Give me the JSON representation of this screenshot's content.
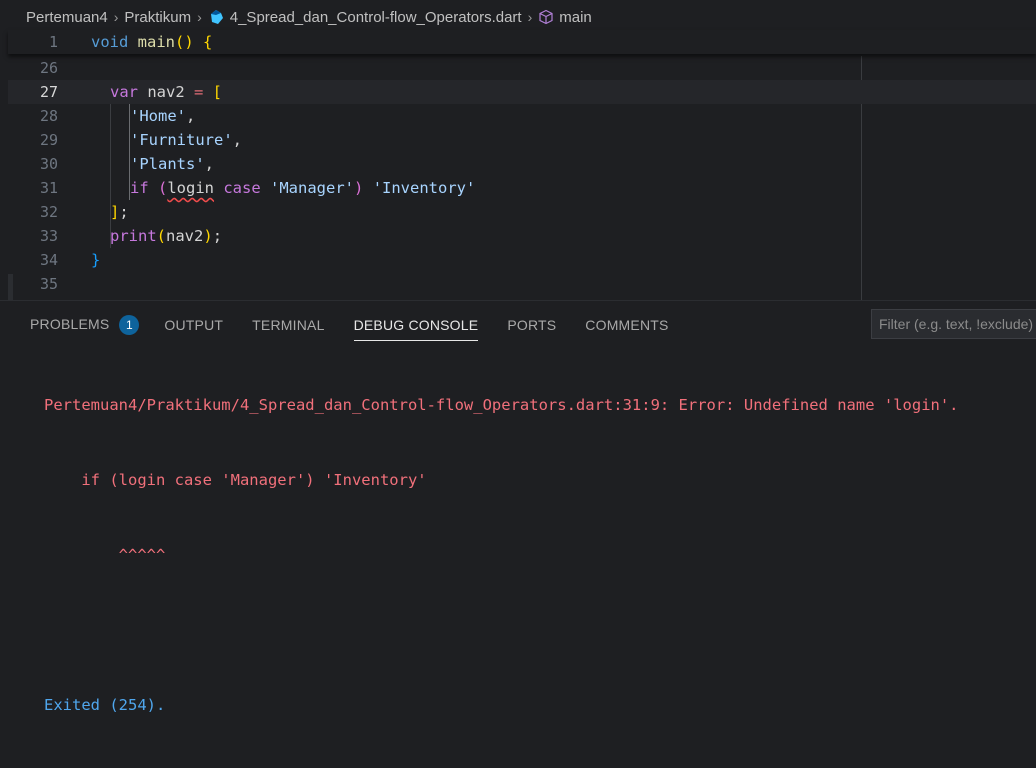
{
  "breadcrumb": {
    "items": [
      "Pertemuan4",
      "Praktikum",
      "4_Spread_dan_Control-flow_Operators.dart",
      "main"
    ],
    "separator": ">"
  },
  "sticky": {
    "line_number": "1",
    "code": "void main() {"
  },
  "editor": {
    "lines": [
      {
        "num": "26"
      },
      {
        "num": "27"
      },
      {
        "num": "28"
      },
      {
        "num": "29"
      },
      {
        "num": "30"
      },
      {
        "num": "31"
      },
      {
        "num": "32"
      },
      {
        "num": "33"
      },
      {
        "num": "34"
      },
      {
        "num": "35"
      }
    ],
    "tokens": {
      "l27_var": "var",
      "l27_name": "nav2",
      "l27_eq": " = ",
      "l27_br": "[",
      "l28": "'Home'",
      "l28c": ",",
      "l29": "'Furniture'",
      "l29c": ",",
      "l30": "'Plants'",
      "l30c": ",",
      "l31_if": "if",
      "l31_p": " (",
      "l31_login": "login",
      "l31_case": " case ",
      "l31_mgr": "'Manager'",
      "l31_pc": ")",
      "l31_inv": " 'Inventory'",
      "l32": "]",
      "l32s": ";",
      "l33_print": "print",
      "l33_p": "(",
      "l33_arg": "nav2",
      "l33_pc": ")",
      "l33_s": ";",
      "l34": "}"
    }
  },
  "panel": {
    "tabs": [
      "PROBLEMS",
      "OUTPUT",
      "TERMINAL",
      "DEBUG CONSOLE",
      "PORTS",
      "COMMENTS"
    ],
    "problems_count": "1",
    "active_tab": "DEBUG CONSOLE",
    "filter_placeholder": "Filter (e.g. text, !exclude)"
  },
  "console": {
    "error_line": "Pertemuan4/Praktikum/4_Spread_dan_Control-flow_Operators.dart:31:9: Error: Undefined name 'login'.",
    "code_line": "    if (login case 'Manager') 'Inventory'",
    "caret_line": "        ^^^^^",
    "exit_line": "Exited (254)."
  },
  "colors": {
    "background": "#1e1f22",
    "error": "#f1707b",
    "info": "#4fa6ed",
    "badge": "#0e639c"
  }
}
